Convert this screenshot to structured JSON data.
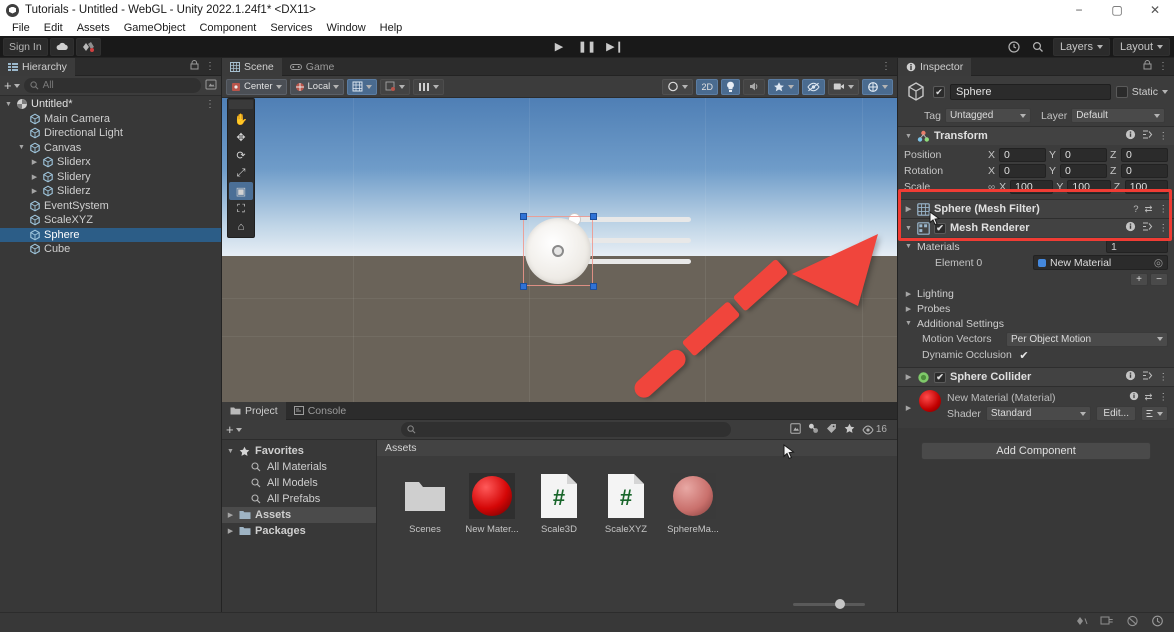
{
  "window": {
    "title": "Tutorials - Untitled - WebGL - Unity 2022.1.24f1* <DX11>",
    "minimize": "−",
    "maximize": "▢",
    "close": "✕"
  },
  "menubar": [
    "File",
    "Edit",
    "Assets",
    "GameObject",
    "Component",
    "Services",
    "Window",
    "Help"
  ],
  "toolbar": {
    "signin": "Sign In",
    "cloud_icon": "cloud-icon",
    "collab_icon": "collab-icon",
    "play": "▶",
    "pause": "❚❚",
    "step": "▶❙",
    "account_icon": "account-icon",
    "search_icon": "search-icon",
    "layers": "Layers",
    "layout": "Layout"
  },
  "hierarchy": {
    "tab": "Hierarchy",
    "lock_icon": "lock-icon",
    "menu_icon": "kebab-menu-icon",
    "add_label": "+",
    "search_placeholder": "All",
    "visibility_icon": "visibility-icon",
    "items": [
      {
        "label": "Untitled*",
        "depth": 0,
        "arrow": "▼",
        "icon": "scene-icon",
        "selected": false
      },
      {
        "label": "Main Camera",
        "depth": 1,
        "arrow": "",
        "icon": "gameobject-icon",
        "selected": false
      },
      {
        "label": "Directional Light",
        "depth": 1,
        "arrow": "",
        "icon": "gameobject-icon",
        "selected": false
      },
      {
        "label": "Canvas",
        "depth": 1,
        "arrow": "▼",
        "icon": "gameobject-icon",
        "selected": false
      },
      {
        "label": "Sliderx",
        "depth": 2,
        "arrow": "▶",
        "icon": "gameobject-icon",
        "selected": false
      },
      {
        "label": "Slidery",
        "depth": 2,
        "arrow": "▶",
        "icon": "gameobject-icon",
        "selected": false
      },
      {
        "label": "Sliderz",
        "depth": 2,
        "arrow": "▶",
        "icon": "gameobject-icon",
        "selected": false
      },
      {
        "label": "EventSystem",
        "depth": 1,
        "arrow": "",
        "icon": "gameobject-icon",
        "selected": false
      },
      {
        "label": "ScaleXYZ",
        "depth": 1,
        "arrow": "",
        "icon": "gameobject-icon",
        "selected": false
      },
      {
        "label": "Sphere",
        "depth": 1,
        "arrow": "",
        "icon": "gameobject-icon",
        "selected": true
      },
      {
        "label": "Cube",
        "depth": 1,
        "arrow": "",
        "icon": "gameobject-icon",
        "selected": false
      }
    ]
  },
  "scene": {
    "tab_scene": "Scene",
    "tab_game": "Game",
    "menu_icon": "kebab-menu-icon",
    "pivot_mode": "Center",
    "handle_space": "Local",
    "grid_icon": "grid-snap-icon",
    "snap_icon": "snap-increment-icon",
    "layout_icon": "view-layout-icon",
    "shading_icon": "shading-mode-icon",
    "mode_2d": "2D",
    "light_icon": "scene-lighting-icon",
    "audio_icon": "scene-audio-icon",
    "fx_icon": "scene-fx-icon",
    "hidden_icon": "scene-visibility-icon",
    "camera_icon": "scene-camera-icon",
    "gizmos_icon": "gizmos-icon",
    "tools": [
      {
        "name": "hand-tool",
        "glyph": "✋",
        "active": false
      },
      {
        "name": "move-tool",
        "glyph": "✥",
        "active": false
      },
      {
        "name": "rotate-tool",
        "glyph": "⟳",
        "active": false
      },
      {
        "name": "scale-tool",
        "glyph": "⤢",
        "active": false
      },
      {
        "name": "rect-tool",
        "glyph": "▣",
        "active": true
      },
      {
        "name": "transform-tool",
        "glyph": "⛶",
        "active": false
      },
      {
        "name": "custom-tool",
        "glyph": "⌂",
        "active": false
      }
    ]
  },
  "project": {
    "tab_project": "Project",
    "tab_console": "Console",
    "add_label": "+",
    "search_placeholder": "",
    "search_icon": "search-icon",
    "filter_icons": [
      "packages-filter-icon",
      "type-filter-icon",
      "label-filter-icon",
      "favorite-icon"
    ],
    "count_badge": "16",
    "tree": [
      {
        "label": "Favorites",
        "depth": 0,
        "arrow": "▼",
        "icon": "star-icon",
        "selected": false
      },
      {
        "label": "All Materials",
        "depth": 1,
        "arrow": "",
        "icon": "search-icon",
        "selected": false
      },
      {
        "label": "All Models",
        "depth": 1,
        "arrow": "",
        "icon": "search-icon",
        "selected": false
      },
      {
        "label": "All Prefabs",
        "depth": 1,
        "arrow": "",
        "icon": "search-icon",
        "selected": false
      },
      {
        "label": "Assets",
        "depth": 0,
        "arrow": "▶",
        "icon": "folder-icon",
        "selected": true
      },
      {
        "label": "Packages",
        "depth": 0,
        "arrow": "▶",
        "icon": "folder-icon",
        "selected": false
      }
    ],
    "assets_header": "Assets",
    "assets": [
      {
        "label": "Scenes",
        "type": "folder"
      },
      {
        "label": "New Mater...",
        "type": "material-red"
      },
      {
        "label": "Scale3D",
        "type": "script"
      },
      {
        "label": "ScaleXYZ",
        "type": "script"
      },
      {
        "label": "SphereMa...",
        "type": "material-pink"
      }
    ]
  },
  "inspector": {
    "tab": "Inspector",
    "lock_icon": "lock-icon",
    "menu_icon": "kebab-menu-icon",
    "object_name": "Sphere",
    "enabled": true,
    "static_label": "Static",
    "tag_label": "Tag",
    "tag_value": "Untagged",
    "layer_label": "Layer",
    "layer_value": "Default",
    "transform": {
      "title": "Transform",
      "help_icon": "help-icon",
      "preset_icon": "preset-icon",
      "menu_icon": "kebab-menu-icon",
      "rows": [
        {
          "label": "Position",
          "x": "0",
          "y": "0",
          "z": "0",
          "link": false
        },
        {
          "label": "Rotation",
          "x": "0",
          "y": "0",
          "z": "0",
          "link": false
        },
        {
          "label": "Scale",
          "x": "100",
          "y": "100",
          "z": "100",
          "link": true
        }
      ],
      "axis_labels": [
        "X",
        "Y",
        "Z"
      ]
    },
    "mesh_filter": {
      "title": "Sphere (Mesh Filter)",
      "icon": "mesh-filter-icon"
    },
    "mesh_renderer": {
      "title": "Mesh Renderer",
      "icon": "mesh-renderer-icon",
      "enabled": true,
      "materials_label": "Materials",
      "materials_count": "1",
      "element_label": "Element 0",
      "element_value": "New Material",
      "plus": "+",
      "minus": "−",
      "lighting_label": "Lighting",
      "probes_label": "Probes",
      "additional_label": "Additional Settings",
      "motion_vectors_label": "Motion Vectors",
      "motion_vectors_value": "Per Object Motion",
      "dynamic_occlusion_label": "Dynamic Occlusion",
      "dynamic_occlusion_checked": true
    },
    "sphere_collider": {
      "title": "Sphere Collider",
      "icon": "collider-icon",
      "enabled": true
    },
    "material": {
      "title": "New Material (Material)",
      "shader_label": "Shader",
      "shader_value": "Standard",
      "edit_label": "Edit...",
      "preset_icon": "preset-icon"
    },
    "add_component": "Add Component"
  },
  "statusbar": {
    "icons": [
      "collab-status-icon",
      "cloud-status-icon",
      "notification-icon",
      "progress-icon"
    ]
  },
  "annotations": {
    "highlight_color": "#f03c34",
    "arrow_color": "#f0453c",
    "highlight_target": "Mesh Renderer component header",
    "arrow_points_to": "Mesh Renderer highlight"
  }
}
